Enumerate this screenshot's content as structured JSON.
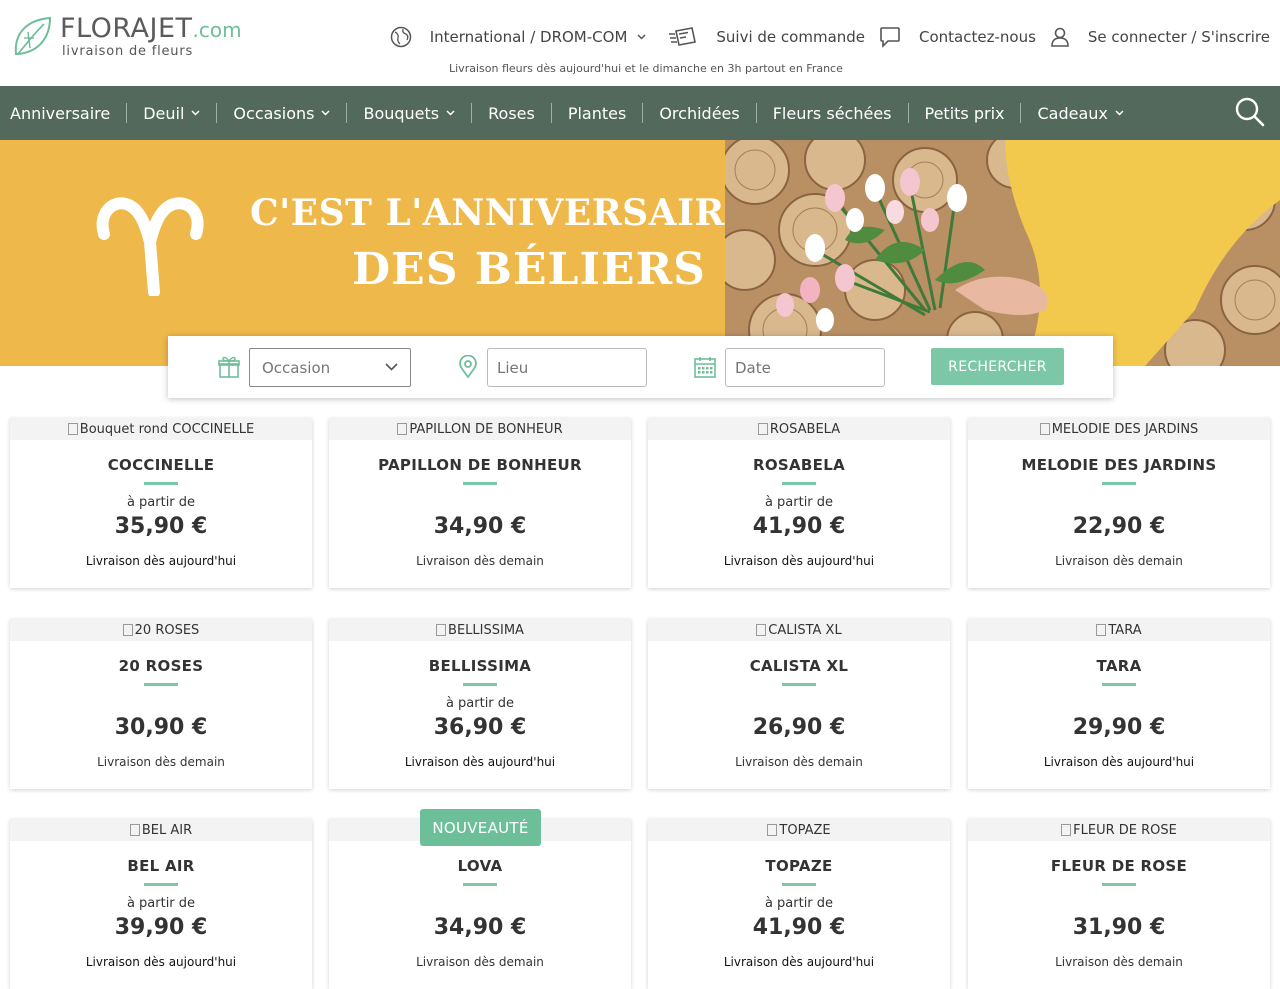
{
  "header": {
    "logo_brand": "FLORAJET",
    "logo_domain": ".com",
    "logo_tagline": "livraison de fleurs",
    "links": {
      "international": "International / DROM-COM",
      "tracking": "Suivi de commande",
      "contact": "Contactez-nous",
      "account": "Se connecter / S'inscrire"
    },
    "tagline": "Livraison fleurs dès aujourd'hui et le dimanche en 3h partout en France"
  },
  "nav": {
    "items": [
      {
        "label": "Anniversaire",
        "dropdown": false
      },
      {
        "label": "Deuil",
        "dropdown": true
      },
      {
        "label": "Occasions",
        "dropdown": true
      },
      {
        "label": "Bouquets",
        "dropdown": true
      },
      {
        "label": "Roses",
        "dropdown": false
      },
      {
        "label": "Plantes",
        "dropdown": false
      },
      {
        "label": "Orchidées",
        "dropdown": false
      },
      {
        "label": "Fleurs séchées",
        "dropdown": false
      },
      {
        "label": "Petits prix",
        "dropdown": false
      },
      {
        "label": "Cadeaux",
        "dropdown": true
      }
    ]
  },
  "banner": {
    "line1": "C'EST L'ANNIVERSAIRE",
    "line2": "DES BÉLIERS"
  },
  "search": {
    "occasion_placeholder": "Occasion",
    "place_placeholder": "Lieu",
    "date_placeholder": "Date",
    "button_label": "RECHERCHER"
  },
  "products": [
    {
      "img_alt": "Bouquet rond COCCINELLE",
      "name": "COCCINELLE",
      "from": "à partir de",
      "price": "35,90 €",
      "delivery": "Livraison dès aujourd'hui"
    },
    {
      "img_alt": "PAPILLON DE BONHEUR",
      "name": "PAPILLON DE BONHEUR",
      "from": "",
      "price": "34,90 €",
      "delivery": "Livraison dès demain"
    },
    {
      "img_alt": "ROSABELA",
      "name": "ROSABELA",
      "from": "à partir de",
      "price": "41,90 €",
      "delivery": "Livraison dès aujourd'hui"
    },
    {
      "img_alt": "MELODIE DES JARDINS",
      "name": "MELODIE DES JARDINS",
      "from": "",
      "price": "22,90 €",
      "delivery": "Livraison dès demain"
    },
    {
      "img_alt": "20 ROSES",
      "name": "20 ROSES",
      "from": "",
      "price": "30,90 €",
      "delivery": "Livraison dès demain"
    },
    {
      "img_alt": "BELLISSIMA",
      "name": "BELLISSIMA",
      "from": "à partir de",
      "price": "36,90 €",
      "delivery": "Livraison dès aujourd'hui"
    },
    {
      "img_alt": "CALISTA XL",
      "name": "CALISTA XL",
      "from": "",
      "price": "26,90 €",
      "delivery": "Livraison dès demain"
    },
    {
      "img_alt": "TARA",
      "name": "TARA",
      "from": "",
      "price": "29,90 €",
      "delivery": "Livraison dès aujourd'hui"
    },
    {
      "img_alt": "BEL AIR",
      "name": "BEL AIR",
      "from": "à partir de",
      "price": "39,90 €",
      "delivery": "Livraison dès aujourd'hui"
    },
    {
      "img_alt": "",
      "name": "LOVA",
      "from": "",
      "price": "34,90 €",
      "delivery": "Livraison dès demain",
      "badge": "NOUVEAUTÉ"
    },
    {
      "img_alt": "TOPAZE",
      "name": "TOPAZE",
      "from": "à partir de",
      "price": "41,90 €",
      "delivery": "Livraison dès aujourd'hui"
    },
    {
      "img_alt": "FLEUR DE ROSE",
      "name": "FLEUR DE ROSE",
      "from": "",
      "price": "31,90 €",
      "delivery": "Livraison dès demain"
    }
  ],
  "colors": {
    "nav_bg": "#52695b",
    "accent_green": "#7cc7a5",
    "banner_yellow": "#eeb84a"
  }
}
